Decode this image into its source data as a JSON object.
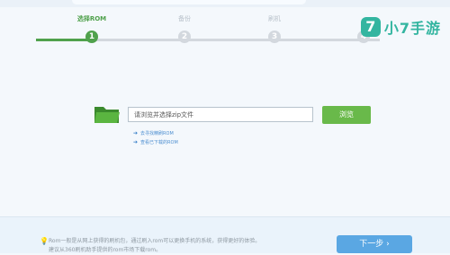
{
  "steps": [
    {
      "label": "选择ROM",
      "number": "1",
      "state": "active"
    },
    {
      "label": "备份",
      "number": "2",
      "state": "inactive"
    },
    {
      "label": "刷机",
      "number": "3",
      "state": "inactive"
    },
    {
      "label": "",
      "number": "4",
      "state": "inactive"
    }
  ],
  "brand": {
    "logo": "7",
    "name": "小7手游"
  },
  "rom": {
    "input_value": "请浏览并选择zip文件",
    "browse_label": "浏览",
    "links": [
      "去寻找精刷ROM",
      "查看已下载的ROM"
    ]
  },
  "footer": {
    "tip_line1": "Rom一般是从网上获得的刷机包，通过刷入rom可以更换手机的系统，获得更好的体验。",
    "tip_line2": "建议从360刷机助手提供的rom市场下载rom。",
    "next_label": "下一步"
  },
  "colors": {
    "active": "#4fa14c",
    "inactive": "#d3d8de",
    "brand": "#33b5a0",
    "primary": "#5aa7e3"
  }
}
